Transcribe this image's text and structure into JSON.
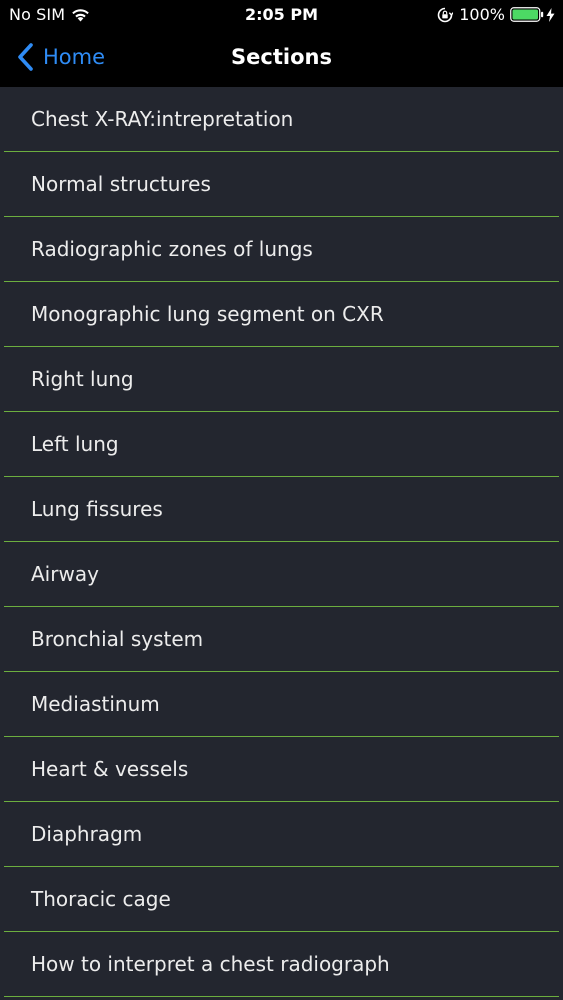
{
  "status_bar": {
    "carrier": "No SIM",
    "time": "2:05 PM",
    "battery": "100%",
    "icons": [
      "wifi-icon",
      "orientation-lock-icon",
      "battery-icon",
      "charging-bolt-icon"
    ]
  },
  "nav": {
    "back_label": "Home",
    "title": "Sections",
    "accent_color": "#2f8cf5"
  },
  "sections": [
    {
      "label": "Chest X-RAY:intrepretation"
    },
    {
      "label": "Normal structures"
    },
    {
      "label": "Radiographic zones of lungs"
    },
    {
      "label": "Monographic lung segment on CXR"
    },
    {
      "label": "Right lung"
    },
    {
      "label": "Left lung"
    },
    {
      "label": "Lung fissures"
    },
    {
      "label": "Airway"
    },
    {
      "label": "Bronchial system"
    },
    {
      "label": "Mediastinum"
    },
    {
      "label": "Heart & vessels"
    },
    {
      "label": "Diaphragm"
    },
    {
      "label": "Thoracic cage"
    },
    {
      "label": "How to interpret a chest radiograph"
    }
  ],
  "colors": {
    "background": "#23262f",
    "divider": "#6cae3f",
    "bars": "#000000"
  }
}
